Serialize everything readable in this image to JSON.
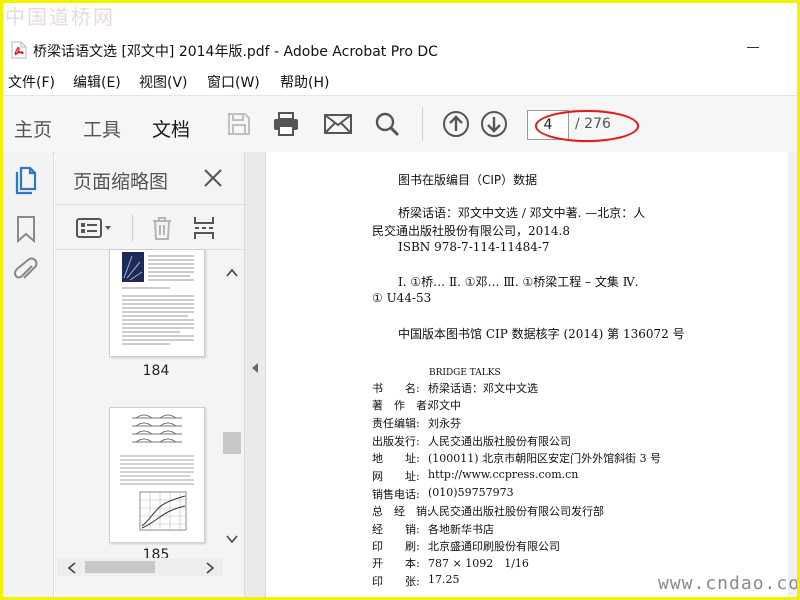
{
  "watermark_top": "中国道桥网",
  "watermark_bottom": "www.cndao.com",
  "window": {
    "title": "桥梁话语文选 [邓文中] 2014年版.pdf - Adobe Acrobat Pro DC"
  },
  "menu": [
    "文件(F)",
    "编辑(E)",
    "视图(V)",
    "窗口(W)",
    "帮助(H)"
  ],
  "tabs": [
    "主页",
    "工具",
    "文档"
  ],
  "active_tab": "文档",
  "page_nav": {
    "current": "4",
    "total": "/ 276"
  },
  "thumb_panel": {
    "title": "页面缩略图",
    "pages": [
      "184",
      "185"
    ]
  },
  "document": {
    "cip_header": "图书在版编目（CIP）数据",
    "cip_lines": [
      "桥梁话语：邓文中文选 / 邓文中著. —北京：人",
      "民交通出版社股份有限公司，2014.8",
      "ISBN  978-7-114-11484-7"
    ],
    "classification": [
      "Ⅰ. ①桥… Ⅱ. ①邓… Ⅲ. ①桥梁工程 – 文集 Ⅳ.",
      "① U44-53"
    ],
    "cip_number": "中国版本图书馆 CIP 数据核字 (2014) 第 136072 号",
    "english_title": "BRIDGE TALKS",
    "credits": [
      {
        "label": "书　　名:",
        "value": "桥梁话语：邓文中文选"
      },
      {
        "label": "著　作　者:",
        "value": "邓文中"
      },
      {
        "label": "责任编辑:",
        "value": "刘永芬"
      },
      {
        "label": "出版发行:",
        "value": "人民交通出版社股份有限公司"
      },
      {
        "label": "地　　址:",
        "value": "(100011) 北京市朝阳区安定门外外馆斜街 3 号"
      },
      {
        "label": "网　　址:",
        "value": "http://www.ccpress.com.cn"
      },
      {
        "label": "销售电话:",
        "value": "(010)59757973"
      },
      {
        "label": "总　经　销:",
        "value": "人民交通出版社股份有限公司发行部"
      },
      {
        "label": "经　　销:",
        "value": "各地新华书店"
      },
      {
        "label": "印　　刷:",
        "value": "北京盛通印刷股份有限公司"
      },
      {
        "label": "开　　本:",
        "value": "787 × 1092　1/16"
      },
      {
        "label": "印　　张:",
        "value": "17.25"
      }
    ]
  },
  "colors": {
    "frame": "#f2f200",
    "annotation": "#d62020",
    "pdf_red": "#d9221c"
  },
  "icons": [
    "pdf-file-icon",
    "save-icon",
    "print-icon",
    "email-icon",
    "search-icon",
    "prev-page-icon",
    "next-page-icon",
    "pages-icon",
    "bookmark-icon",
    "attachment-icon",
    "close-icon",
    "thumb-options-icon",
    "delete-icon",
    "insert-pages-icon",
    "scroll-up-icon",
    "scroll-down-icon",
    "scroll-left-icon",
    "scroll-right-icon",
    "collapse-panel-icon"
  ]
}
